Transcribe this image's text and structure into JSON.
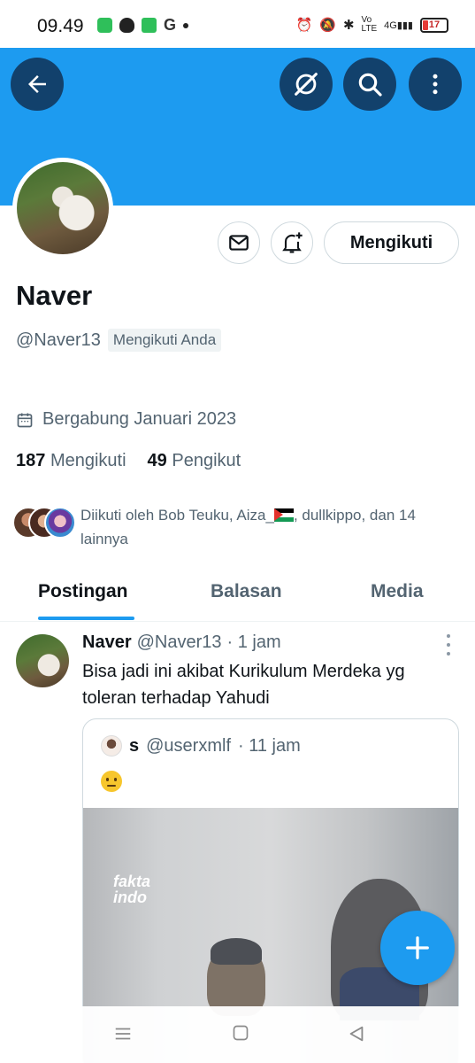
{
  "status_bar": {
    "time": "09.49",
    "battery": "17",
    "network": "4G"
  },
  "header": {
    "back_icon": "arrow-left-icon",
    "grok_icon": "grok-icon",
    "search_icon": "search-icon",
    "more_icon": "more-vertical-icon",
    "banner_color": "#1d9bf0"
  },
  "profile": {
    "name": "Naver",
    "handle": "@Naver13",
    "follows_you_badge": "Mengikuti Anda",
    "joined": "Bergabung Januari 2023",
    "following_count": "187",
    "following_label": "Mengikuti",
    "followers_count": "49",
    "followers_label": "Pengikut",
    "follow_button_label": "Mengikuti",
    "followed_by_prefix": "Diikuti oleh Bob Teuku, Aiza_",
    "followed_by_suffix": ", dullkippo, dan 14 lainnya"
  },
  "tabs": [
    {
      "label": "Postingan",
      "active": true
    },
    {
      "label": "Balasan",
      "active": false
    },
    {
      "label": "Media",
      "active": false
    }
  ],
  "tweet": {
    "name": "Naver",
    "handle": "@Naver13",
    "time": "· 1 jam",
    "text": "Bisa jadi ini akibat Kurikulum Merdeka yg toleran terhadap Yahudi",
    "quote": {
      "name": "s",
      "handle": "@userxmlf",
      "time": "· 11 jam",
      "emoji": "melting-face-emoji",
      "watermark_line1": "fakta",
      "watermark_line2": "indo"
    }
  },
  "fab_icon": "plus-icon",
  "accent_color": "#1d9bf0"
}
